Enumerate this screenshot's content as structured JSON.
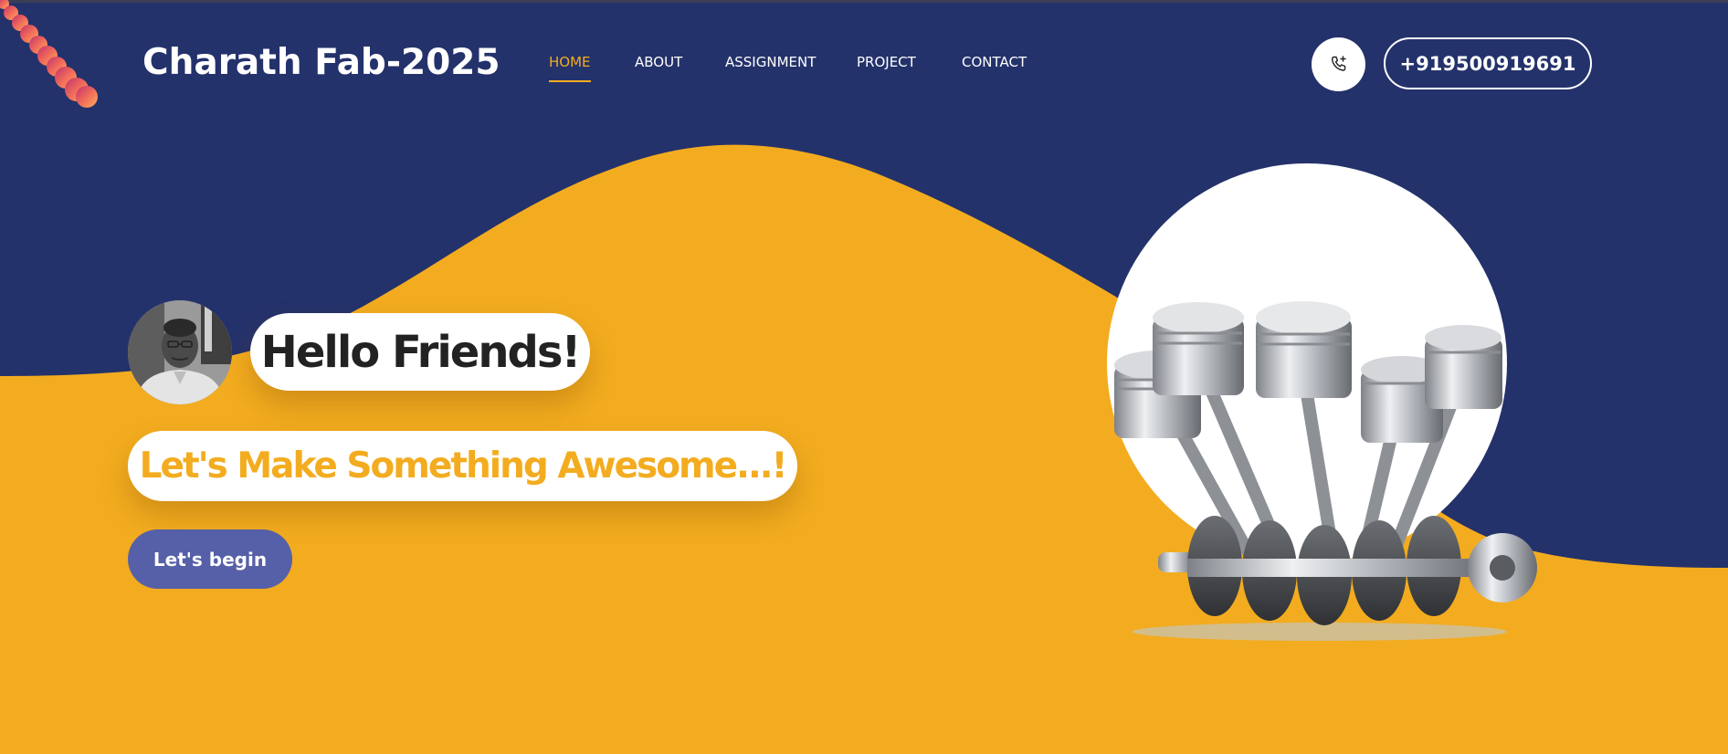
{
  "header": {
    "logo": "Charath Fab-2025",
    "nav": [
      {
        "label": "HOME",
        "active": true
      },
      {
        "label": "ABOUT",
        "active": false
      },
      {
        "label": "ASSIGNMENT",
        "active": false
      },
      {
        "label": "PROJECT",
        "active": false
      },
      {
        "label": "CONTACT",
        "active": false
      }
    ],
    "phone_icon": "phone-call-icon",
    "phone_number": "+919500919691"
  },
  "hero": {
    "greeting": "Hello Friends!",
    "tagline": "Let's Make Something Awesome...!",
    "cta_label": "Let's begin",
    "avatar": "person-portrait",
    "illustration": "engine-pistons-crankshaft"
  },
  "colors": {
    "navy": "#24326b",
    "accent": "#f3ac1f",
    "button": "#5660a8",
    "white": "#ffffff"
  }
}
